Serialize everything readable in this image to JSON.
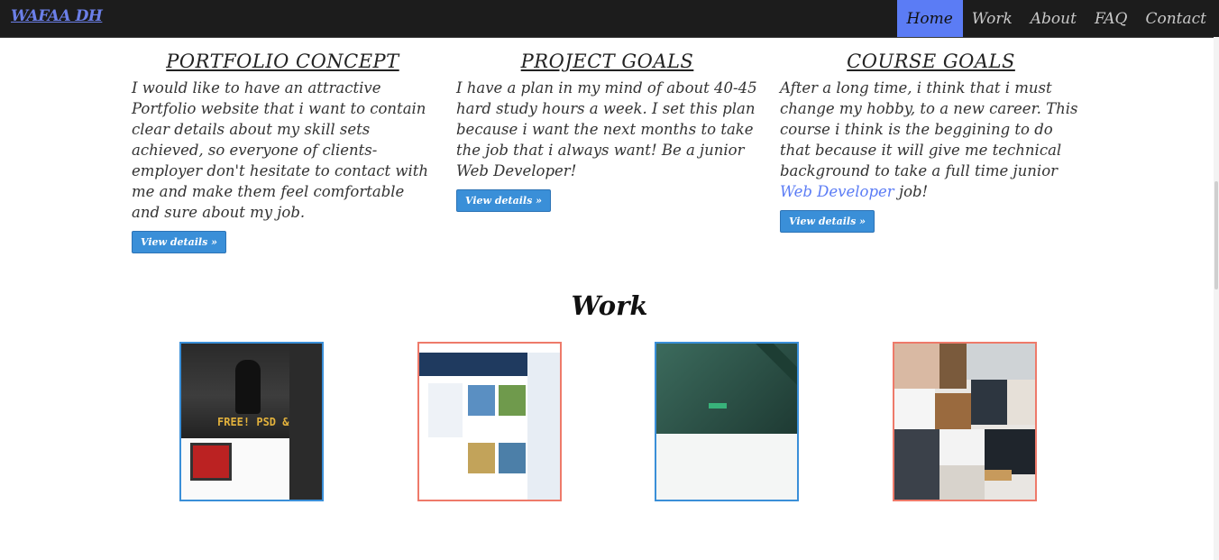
{
  "navbar": {
    "brand": "WAFAA DH",
    "items": [
      {
        "label": "Home",
        "active": true
      },
      {
        "label": "Work",
        "active": false
      },
      {
        "label": "About",
        "active": false
      },
      {
        "label": "FAQ",
        "active": false
      },
      {
        "label": "Contact",
        "active": false
      }
    ]
  },
  "columns": [
    {
      "title": "PORTFOLIO CONCEPT",
      "text": "I would like to have an attractive Portfolio website that i want to contain clear details about my skill sets achieved, so everyone of clients-employer don't hesitate to contact with me and make them feel comfortable and sure about my job.",
      "button": "View details »"
    },
    {
      "title": "PROJECT GOALS",
      "text": "I have a plan in my mind of about 40-45 hard study hours a week. I set this plan because i want the next months to take the job that i always want! Be a junior Web Developer!",
      "button": "View details »"
    },
    {
      "title": "COURSE GOALS",
      "text_before": "After a long time, i think that i must change my hobby, to a new career. This course i think is the beggining to do that because it will give me technical background to take a full time junior ",
      "link": "Web Developer",
      "text_after": " job!",
      "button": "View details »"
    }
  ],
  "work": {
    "title": "Work",
    "thumbnails": [
      {
        "name": "Free PSD template",
        "caption": "FREE! PSD & HTML",
        "border": "#3a8fd8"
      },
      {
        "name": "Business template",
        "border": "#ee7a6a"
      },
      {
        "name": "Green landing template",
        "border": "#3a8fd8"
      },
      {
        "name": "Magazine template",
        "border": "#ee7a6a"
      }
    ]
  },
  "colors": {
    "navbar_bg": "#1c1c1c",
    "accent": "#5b7cf5",
    "button": "#3a8fd8"
  }
}
